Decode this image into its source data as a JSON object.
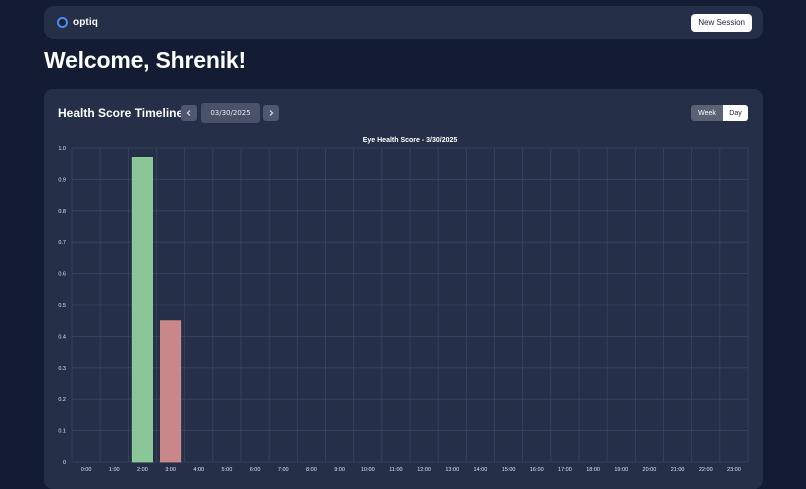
{
  "navbar": {
    "brand": "optiq",
    "new_session_label": "New Session"
  },
  "welcome": "Welcome, Shrenik!",
  "timeline": {
    "title": "Health Score Timeline",
    "date": "03/30/2025",
    "prev_icon": "chevron-left-icon",
    "next_icon": "chevron-right-icon",
    "toggle": {
      "week_label": "Week",
      "day_label": "Day",
      "selected": "Day"
    }
  },
  "colors": {
    "good": "#8fcf9c",
    "bad": "#d28c8e"
  },
  "chart_data": {
    "type": "bar",
    "title": "Eye Health Score - 3/30/2025",
    "categories": [
      "0:00",
      "1:00",
      "2:00",
      "3:00",
      "4:00",
      "5:00",
      "6:00",
      "7:00",
      "8:00",
      "9:00",
      "10:00",
      "11:00",
      "12:00",
      "13:00",
      "14:00",
      "15:00",
      "16:00",
      "17:00",
      "18:00",
      "19:00",
      "20:00",
      "21:00",
      "22:00",
      "23:00"
    ],
    "values": [
      null,
      null,
      0.97,
      0.45,
      null,
      null,
      null,
      null,
      null,
      null,
      null,
      null,
      null,
      null,
      null,
      null,
      null,
      null,
      null,
      null,
      null,
      null,
      null,
      null
    ],
    "bar_colors": {
      "2:00": "#8fcf9c",
      "3:00": "#d28c8e"
    },
    "yticks": [
      "0",
      "0.1",
      "0.2",
      "0.3",
      "0.4",
      "0.5",
      "0.6",
      "0.7",
      "0.8",
      "0.9",
      "1.0"
    ],
    "ylim": [
      0,
      1
    ],
    "grid": true,
    "xlabel": "",
    "ylabel": ""
  }
}
